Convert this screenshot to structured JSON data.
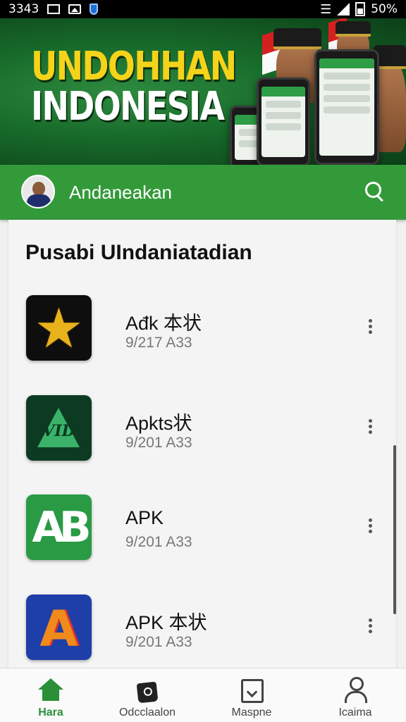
{
  "status_bar": {
    "time": "3343",
    "battery": "50%"
  },
  "banner": {
    "line1": "UNDOHHAN",
    "line2": "INDONESIA"
  },
  "app_bar": {
    "title": "Andaneakan"
  },
  "section": {
    "title": "Pusabi UIndaniatadian"
  },
  "apps": [
    {
      "name": "Ađk 本状",
      "date": "9/217 A33",
      "icon": "star-app-icon"
    },
    {
      "name": "Apkts状",
      "date": "9/201 A33",
      "icon": "triangle-app-icon"
    },
    {
      "name": "APK",
      "date": "9/201 A33",
      "icon": "ab-app-icon"
    },
    {
      "name": "APK 本状",
      "date": "9/201 A33",
      "icon": "a-app-icon"
    }
  ],
  "bottom_nav": [
    {
      "label": "Hara",
      "icon": "home-icon",
      "active": true
    },
    {
      "label": "Odcclaalon",
      "icon": "bag-icon",
      "active": false
    },
    {
      "label": "Maspne",
      "icon": "tray-icon",
      "active": false
    },
    {
      "label": "Icaima",
      "icon": "user-icon",
      "active": false
    }
  ],
  "colors": {
    "accent": "#339a3a",
    "banner_yellow": "#f5d31a",
    "status_bar": "#000000"
  }
}
